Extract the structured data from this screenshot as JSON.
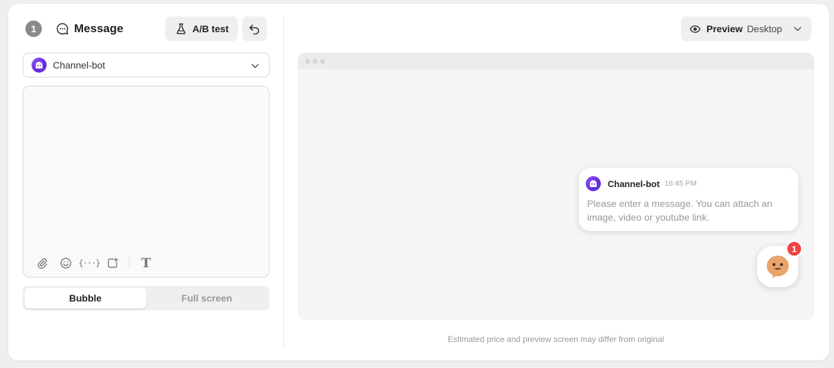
{
  "header": {
    "step_number": "1",
    "title": "Message",
    "ab_test_label": "A/B test"
  },
  "bot_select": {
    "selected": "Channel-bot"
  },
  "editor": {
    "value": "",
    "toolbar_icons": [
      "attach-icon",
      "emoji-icon",
      "variable-icon",
      "add-media-icon",
      "text-format-icon"
    ]
  },
  "display_toggle": {
    "options": [
      "Bubble",
      "Full screen"
    ],
    "selected": "Bubble"
  },
  "preview": {
    "label": "Preview",
    "mode": "Desktop",
    "bubble": {
      "sender": "Channel-bot",
      "time": "16:45 PM",
      "text": "Please enter a message. You can attach an image, video or youtube link."
    },
    "launcher_badge": "1",
    "footnote": "Estimated price and preview screen may differ from original"
  },
  "colors": {
    "badge_red": "#ef4444",
    "bot_avatar": "#7c3aed",
    "launcher_face": "#e8a46b"
  }
}
